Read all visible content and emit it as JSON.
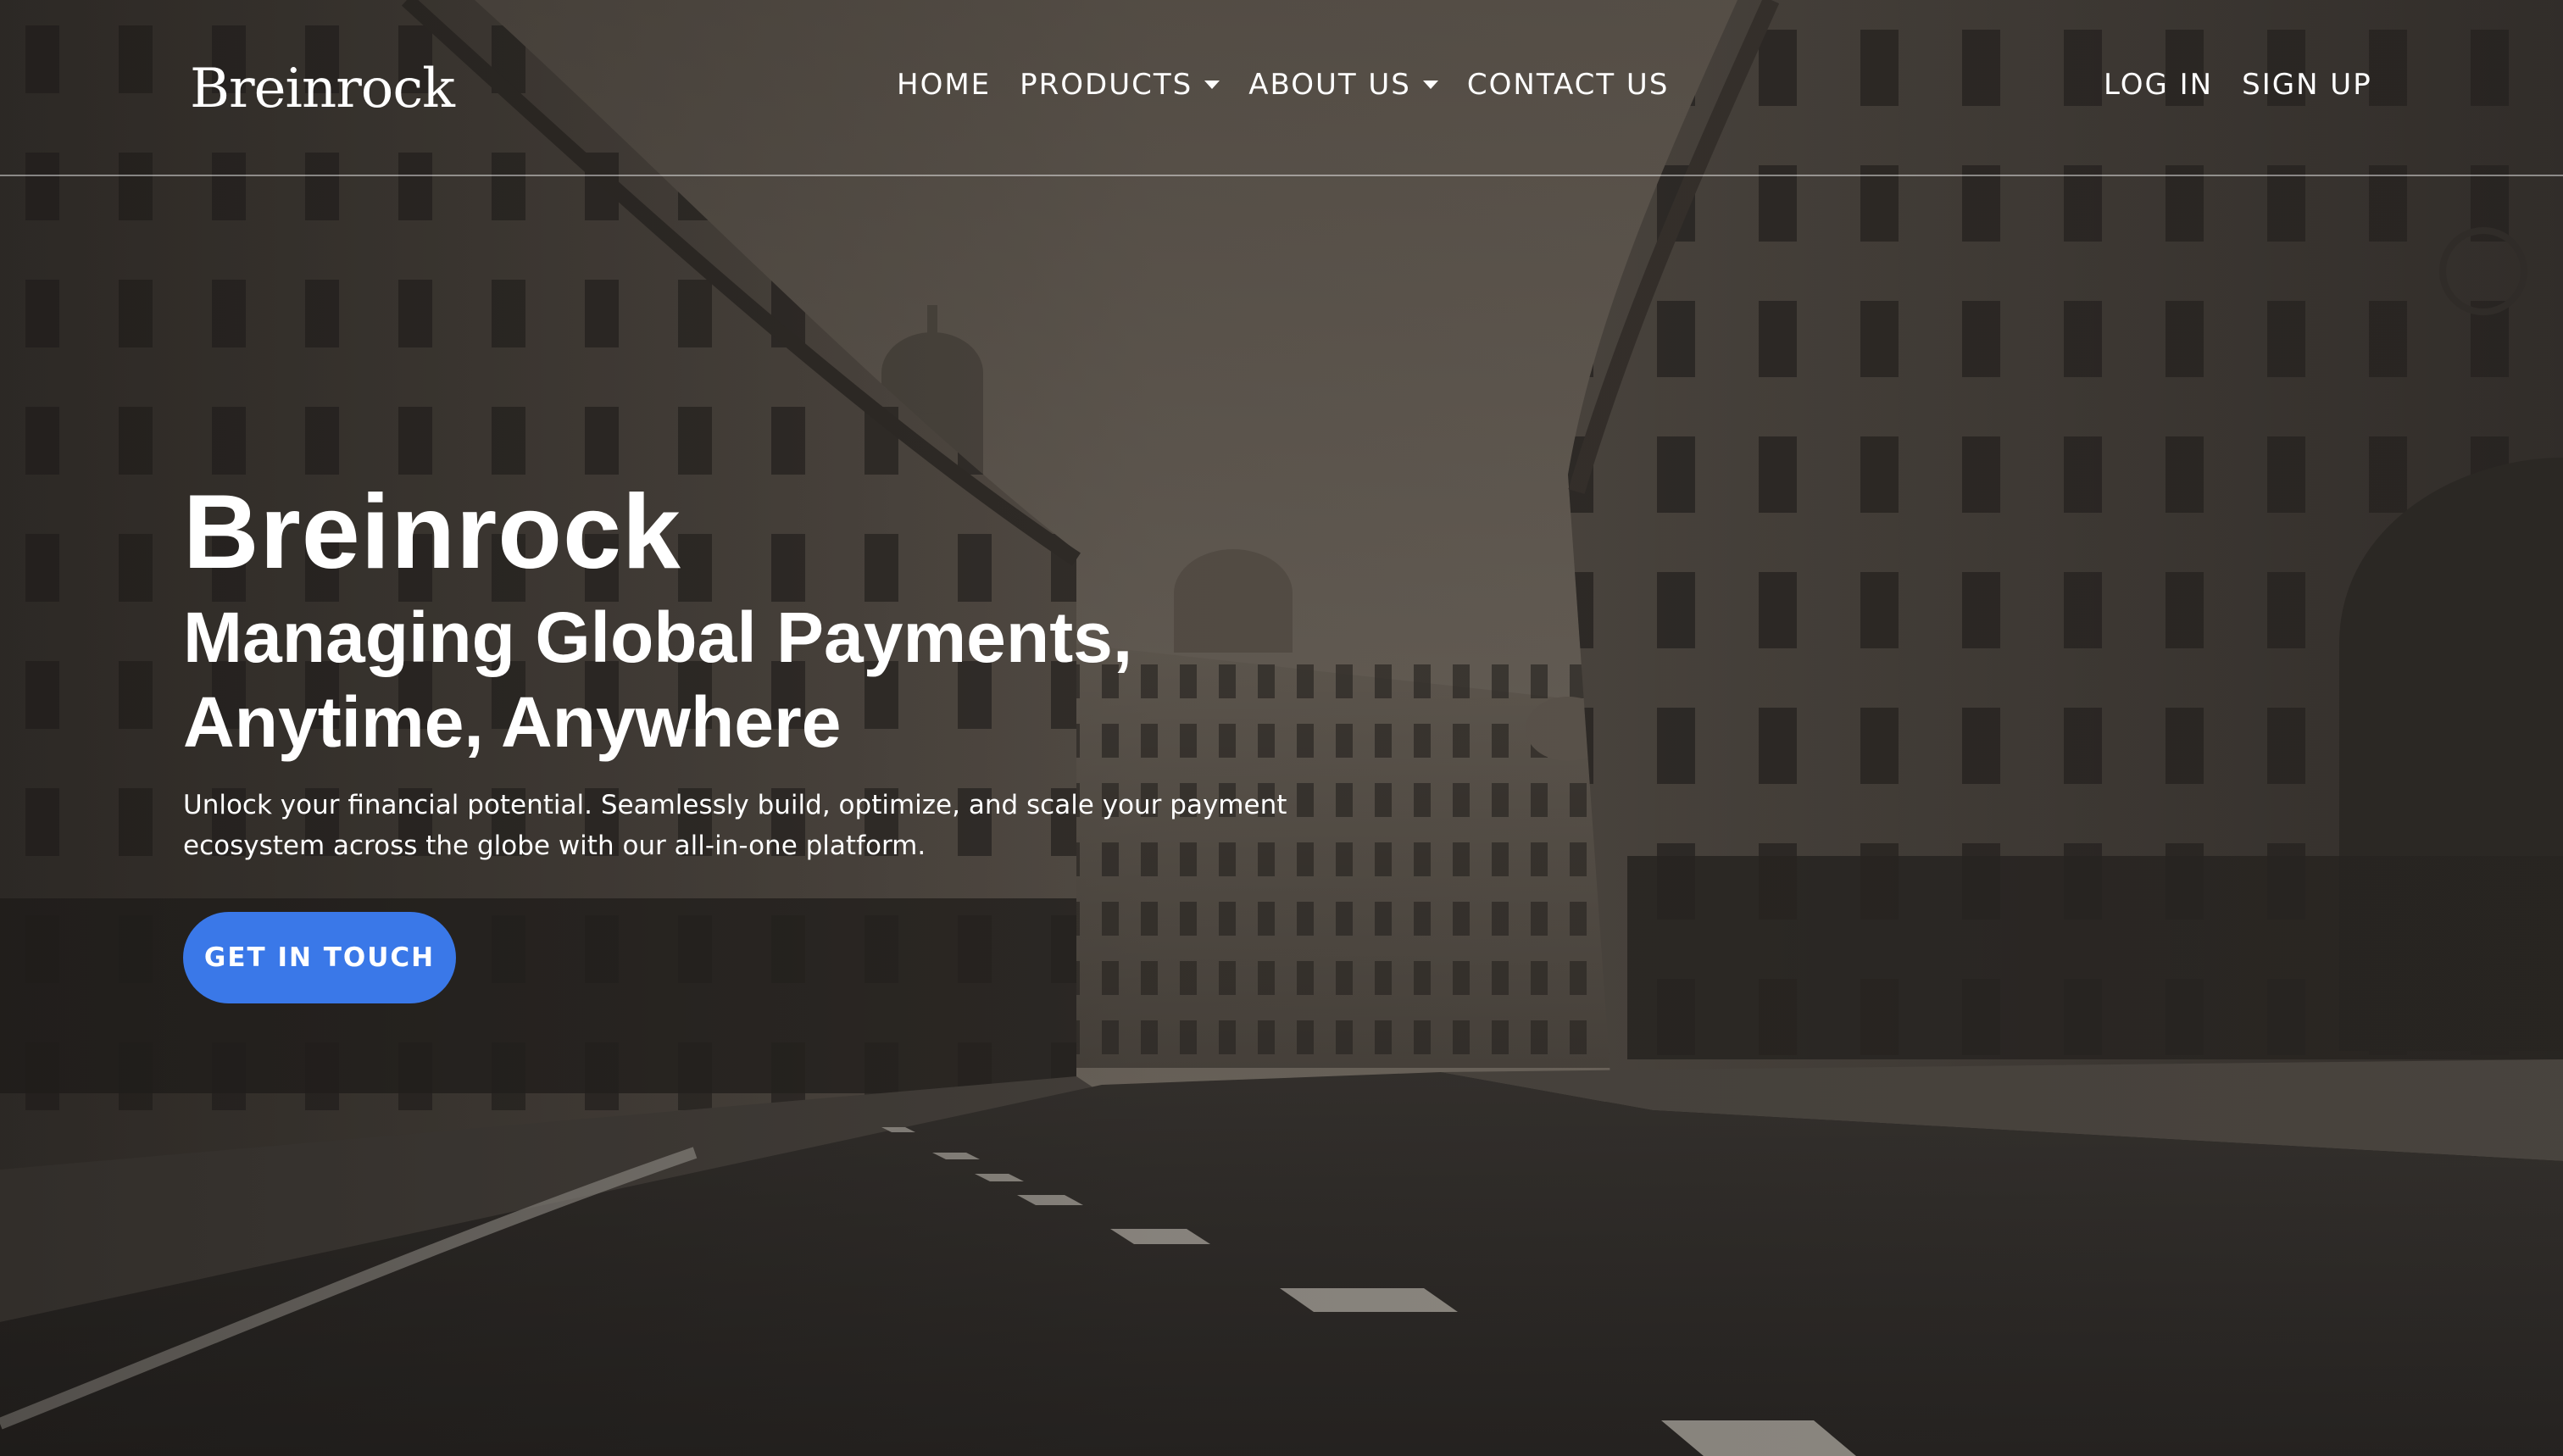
{
  "header": {
    "brand": "Breinrock",
    "nav": {
      "home": "HOME",
      "products": "PRODUCTS",
      "about_us": "ABOUT US",
      "contact_us": "CONTACT US"
    },
    "auth": {
      "log_in": "LOG IN",
      "sign_up": "SIGN UP"
    }
  },
  "hero": {
    "title": "Breinrock",
    "subtitle": "Managing Global Payments, Anytime, Anywhere",
    "description": "Unlock your financial potential. Seamlessly build, optimize, and scale your payment ecosystem across the globe with our all-in-one platform.",
    "cta_label": "GET IN TOUCH"
  },
  "colors": {
    "cta_background": "#3a78e8",
    "text": "#ffffff",
    "overlay": "#2a2724"
  },
  "icons": {
    "products_dropdown": "caret-down-icon",
    "about_dropdown": "caret-down-icon"
  }
}
